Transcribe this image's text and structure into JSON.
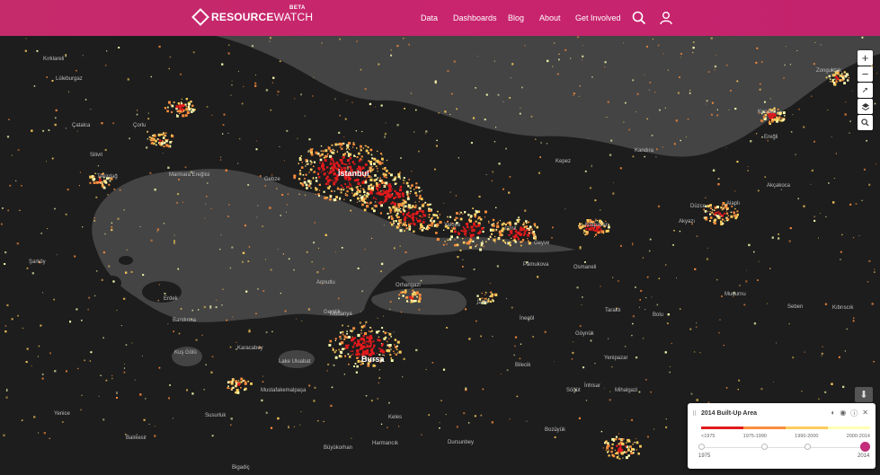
{
  "header": {
    "logo_bold": "RESOURCE",
    "logo_light": "WATCH",
    "beta": "BETA",
    "nav": [
      "Data",
      "Dashboards",
      "Blog",
      "About",
      "Get Involved"
    ]
  },
  "colors": {
    "brand": "#c52a6b",
    "land": "#1d1d1d",
    "water": "#444444",
    "built_1975": "#e31a1c",
    "built_1990": "#fd8d3c",
    "built_2000": "#fecc5c",
    "built_2014": "#ffffb2"
  },
  "map": {
    "places": [
      {
        "name": "İstanbul",
        "big": true
      },
      {
        "name": "Tekirdağ"
      },
      {
        "name": "Marmara Ereğlisi"
      },
      {
        "name": "Bursa",
        "big": true
      },
      {
        "name": "Zonguldak"
      },
      {
        "name": "Kocaeli"
      },
      {
        "name": "İzmit"
      },
      {
        "name": "Adapazarı"
      },
      {
        "name": "Düzce"
      },
      {
        "name": "Bolu"
      },
      {
        "name": "Gemlik"
      },
      {
        "name": "Yalova"
      },
      {
        "name": "Mudanya"
      },
      {
        "name": "Bandırma"
      },
      {
        "name": "Erdek"
      },
      {
        "name": "Karacabey"
      },
      {
        "name": "Lake Uluabat"
      },
      {
        "name": "Kuş Gölü"
      },
      {
        "name": "Mustafakemalpaşa"
      },
      {
        "name": "İnegöl"
      },
      {
        "name": "Bilecik"
      },
      {
        "name": "Bozüyük"
      },
      {
        "name": "Yenice"
      },
      {
        "name": "Susurluk"
      },
      {
        "name": "Balıkesir"
      },
      {
        "name": "Kırklareli"
      },
      {
        "name": "Lüleburgaz"
      },
      {
        "name": "Çorlu"
      },
      {
        "name": "Silivri"
      },
      {
        "name": "Çatalca"
      },
      {
        "name": "Gebze"
      },
      {
        "name": "Kandıra"
      },
      {
        "name": "Akyazı"
      },
      {
        "name": "Geyve"
      },
      {
        "name": "Pamukova"
      },
      {
        "name": "Osmaneli"
      },
      {
        "name": "Mudurnu"
      },
      {
        "name": "Göynük"
      },
      {
        "name": "Taraklı"
      },
      {
        "name": "Yenipazar"
      },
      {
        "name": "İnhisar"
      },
      {
        "name": "Söğüt"
      },
      {
        "name": "Mihalgazi"
      },
      {
        "name": "Seben"
      },
      {
        "name": "Kıbrıscık"
      },
      {
        "name": "Ereğli"
      },
      {
        "name": "Akçakoca"
      },
      {
        "name": "Alaplı"
      },
      {
        "name": "Kepez"
      },
      {
        "name": "Keles"
      },
      {
        "name": "Orhangazi"
      },
      {
        "name": "İznik"
      },
      {
        "name": "Armutlu"
      },
      {
        "name": "Şarköy"
      },
      {
        "name": "Harmancık"
      },
      {
        "name": "Büyükorhan"
      },
      {
        "name": "Dursunbey"
      },
      {
        "name": "Bigadiç"
      }
    ]
  },
  "legend": {
    "title": "2014 Built-Up Area",
    "ramp_labels": [
      "<1975",
      "1975-1990",
      "1990-2000",
      "2000-2014"
    ],
    "ramp_colors": [
      "#e31a1c",
      "#fd8d3c",
      "#fecc5c",
      "#ffffb2"
    ],
    "timeline_start": "1975",
    "timeline_end": "2014",
    "active_year_index": 3
  }
}
